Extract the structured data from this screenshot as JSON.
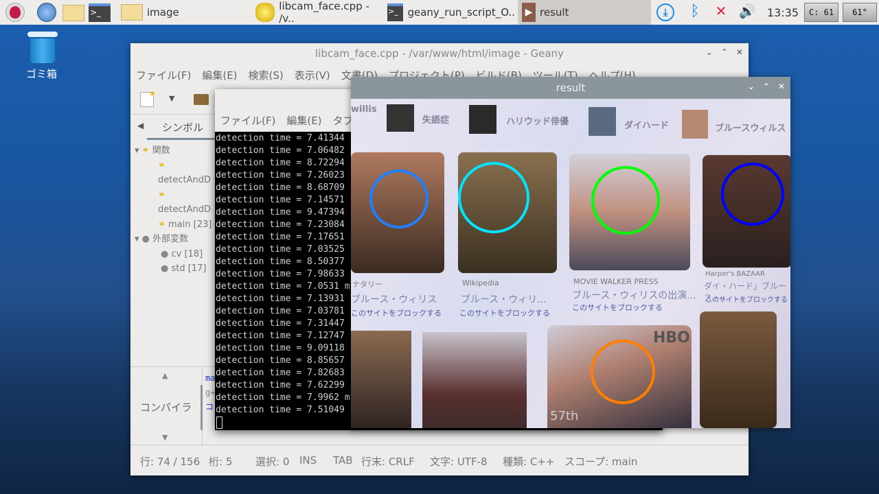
{
  "taskbar": {
    "tasks": [
      {
        "label": "image",
        "icon": "folder-icon"
      },
      {
        "label": "libcam_face.cpp - /v..",
        "icon": "geany-icon"
      },
      {
        "label": "geany_run_script_O..",
        "icon": "terminal-icon"
      },
      {
        "label": "result",
        "icon": "window-icon"
      }
    ],
    "clock": "13:35",
    "cpu": "C: 61",
    "temp": "61°"
  },
  "desktop": {
    "trash_label": "ゴミ箱"
  },
  "geany": {
    "title": "libcam_face.cpp - /var/www/html/image - Geany",
    "menu": [
      "ファイル(F)",
      "編集(E)",
      "検索(S)",
      "表示(V)",
      "文書(D)",
      "プロジェクト(P)",
      "ビルド(B)",
      "ツール(T)",
      "ヘルプ(H)"
    ],
    "sidebar_tab": "シンボル",
    "tree": {
      "functions_label": "関数",
      "functions": [
        "detectAndD",
        "detectAndD",
        "main [23]"
      ],
      "externals_label": "外部変数",
      "externals": [
        "cv [18]",
        "std [17]"
      ]
    },
    "compiler_tab": "コンパイラ",
    "compiler_lines": [
      "ma",
      "g+",
      "コ"
    ],
    "status": [
      "行: 74 / 156",
      "桁: 5",
      "選択: 0",
      "INS",
      "TAB",
      "行末: CRLF",
      "文字: UTF-8",
      "種類: C++",
      "スコープ: main"
    ]
  },
  "terminal": {
    "menu": [
      "ファイル(F)",
      "編集(E)",
      "タブ"
    ],
    "lines": [
      "detection time = 7.41344",
      "detection time = 7.06482",
      "detection time = 8.72294",
      "detection time = 7.26023",
      "detection time = 8.68709",
      "detection time = 7.14571",
      "detection time = 9.47394",
      "detection time = 7.23084",
      "detection time = 7.17651",
      "detection time = 7.03525",
      "detection time = 8.50377",
      "detection time = 7.98633",
      "detection time = 7.0531 m",
      "detection time = 7.13931",
      "detection time = 7.03781",
      "detection time = 7.31447",
      "detection time = 7.12747",
      "detection time = 9.09118",
      "detection time = 8.85657",
      "detection time = 7.82683",
      "detection time = 7.62299",
      "detection time = 7.9962 m",
      "detection time = 7.51049"
    ]
  },
  "result": {
    "title": "result",
    "photo_chips": [
      "willis",
      "失語症",
      "ハリウッド俳優",
      "ダイハード",
      "ブルースウィルス"
    ],
    "photo_sources": [
      "ナタリー",
      "Wikipedia",
      "MOVIE WALKER PRESS",
      "Harper's BAZAAR"
    ],
    "photo_titles": [
      "ブルース・ウィリス",
      "ブルース・ウィリ...",
      "ブルース・ウィリスの出演...",
      "ダイ・ハード」ブルース・..."
    ],
    "photo_block": "このサイトをブロックする",
    "photo_misc": [
      "HBO",
      "57th"
    ],
    "face_colors": [
      "#1e7fff",
      "#00e5ff",
      "#00ff00",
      "#0000ff",
      "#ff7f00"
    ]
  }
}
